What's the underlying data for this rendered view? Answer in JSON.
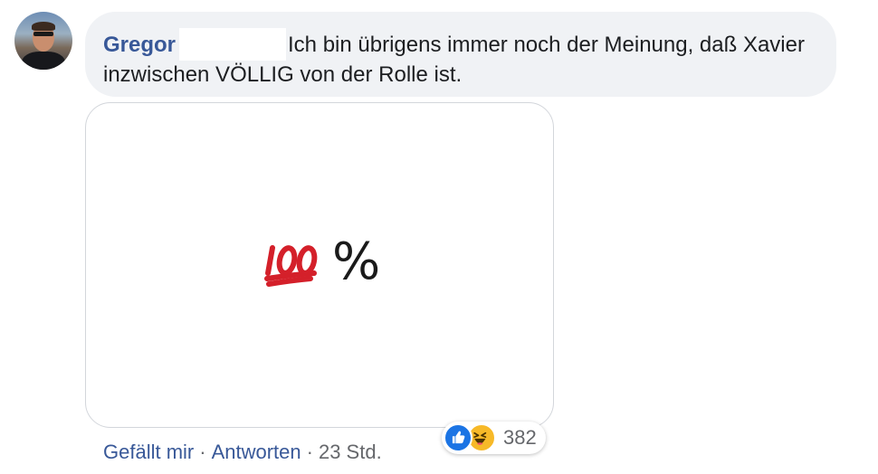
{
  "comment": {
    "author": "Gregor",
    "text": "Ich bin übrigens immer noch der Meinung, daß Xavier inzwischen VÖLLIG von der Rolle ist.",
    "media": {
      "emoji_icon": "hundred-points-emoji",
      "suffix": "%"
    },
    "actions": {
      "like_label": "Gefällt mir",
      "separator": "·",
      "reply_label": "Antworten",
      "timestamp": "23 Std."
    },
    "reactions": {
      "icons": [
        "like-icon",
        "haha-icon"
      ],
      "count": "382"
    }
  },
  "colors": {
    "author_link": "#385898",
    "bubble_bg": "#f0f2f5",
    "meta_text": "#65676b",
    "like_blue": "#1b74e4",
    "haha_yellow": "#f7b928",
    "hundred_red": "#d4202a"
  }
}
